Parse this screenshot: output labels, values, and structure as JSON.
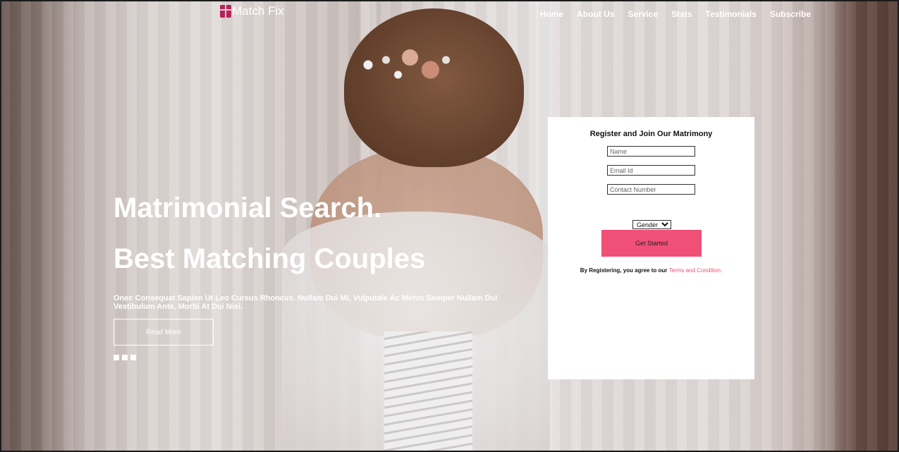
{
  "header": {
    "logo_text": "Match Fix",
    "nav": [
      {
        "label": "Home"
      },
      {
        "label": "About Us"
      },
      {
        "label": "Service"
      },
      {
        "label": "Stats"
      },
      {
        "label": "Testimonials"
      },
      {
        "label": "Subscribe"
      }
    ]
  },
  "hero": {
    "headline_1": "Matrimonial Search.",
    "headline_2": "Best Matching Couples",
    "description": "Onec Consequat Sapien Ut Leo Cursus Rhoncus. Nullam Dui Mi, Vulputale Ac Metus Semper Nullam Dui Vestibulum Ante, Morbi At Dui Nisi.",
    "read_more_label": "Read More",
    "slider_dots": 3
  },
  "register": {
    "title": "Register and Join Our Matrimony",
    "name_placeholder": "Name",
    "email_placeholder": "Email Id",
    "contact_placeholder": "Contact Number",
    "gender_selected": "Gender",
    "submit_label": "Get Started",
    "terms_prefix": "By Registering, you agree to our ",
    "terms_link": "Terms and Condition."
  },
  "colors": {
    "accent": "#f04f77",
    "logo_icon": "#b2245a",
    "text_light": "#ffffff"
  },
  "icons": {
    "logo": "gift-icon",
    "gender_dropdown": "chevron-down-icon"
  }
}
